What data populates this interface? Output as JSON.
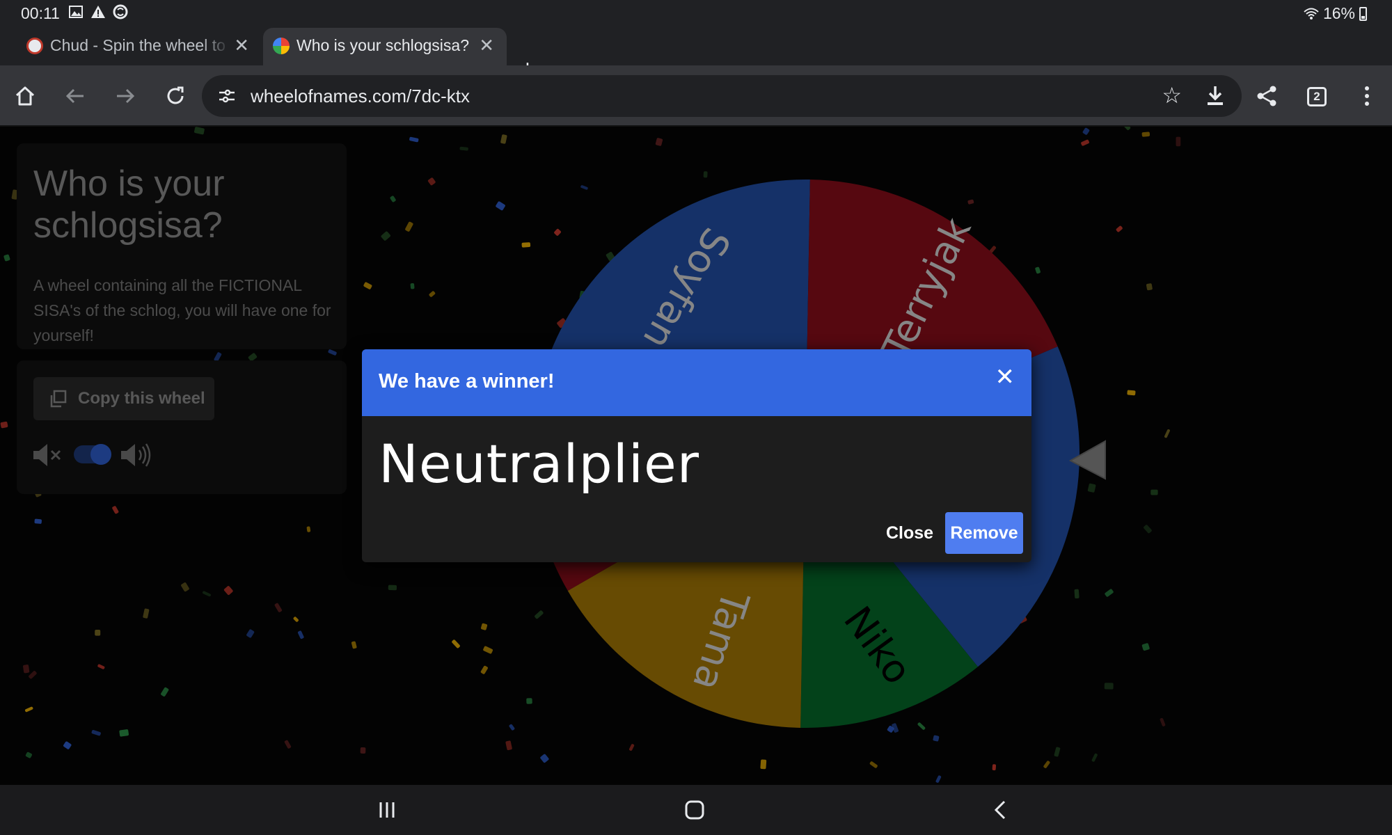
{
  "status_bar": {
    "time": "00:11",
    "battery": "16%",
    "icons": [
      "image-icon",
      "warning-icon",
      "sync-icon",
      "wifi-icon",
      "battery-icon"
    ]
  },
  "tabs": [
    {
      "title": "Chud - Spin the wheel to f",
      "active": false
    },
    {
      "title": "Who is your schlogsisa?",
      "active": true
    }
  ],
  "toolbar": {
    "url": "wheelofnames.com/7dc-ktx",
    "tab_count": "2"
  },
  "sidebar": {
    "title": "Who is your schlogsisa?",
    "description": "A wheel containing all the FICTIONAL SISA's of the schlog, you will have one for yourself!",
    "copy_label": "Copy this wheel",
    "sound_on": true
  },
  "wheel": {
    "segments": [
      {
        "label": "Soyfan",
        "color": "#2250a8"
      },
      {
        "label": "Terryjak",
        "color": "#8c0d1a"
      },
      {
        "label": "Neutralplier",
        "label_visible": "er",
        "color": "#2250a8"
      },
      {
        "label": "Niko",
        "color": "#066b2a"
      },
      {
        "label": "Tama",
        "color": "#a67a06"
      },
      {
        "label": "",
        "color": "#8c0d1a"
      }
    ]
  },
  "modal": {
    "title": "We have a winner!",
    "winner": "Neutralplier",
    "close_label": "Close",
    "remove_label": "Remove"
  },
  "colors": {
    "accent": "#3367e0",
    "remove_button": "#4f7df0",
    "chrome_dark": "#202124",
    "chrome_toolbar": "#35363a"
  }
}
